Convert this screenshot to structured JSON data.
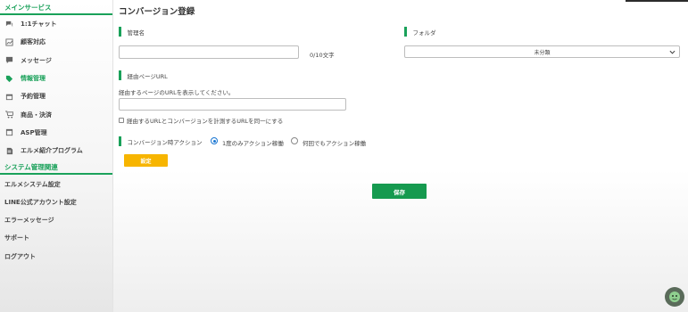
{
  "sidebar": {
    "section_main": "メインサービス",
    "items_main": [
      {
        "label": "1:1チャット",
        "icon": "chat-icon"
      },
      {
        "label": "顧客対応",
        "icon": "chart-icon"
      },
      {
        "label": "メッセージ",
        "icon": "message-icon"
      },
      {
        "label": "情報管理",
        "icon": "tag-icon"
      },
      {
        "label": "予約管理",
        "icon": "calendar-icon"
      },
      {
        "label": "商品・決済",
        "icon": "cart-icon"
      },
      {
        "label": "ASP管理",
        "icon": "window-icon"
      },
      {
        "label": "エルメ紹介プログラム",
        "icon": "document-icon"
      }
    ],
    "section_system": "システム管理関連",
    "items_system": [
      {
        "label": "エルメシステム設定"
      },
      {
        "label": "LINE公式アカウント設定"
      },
      {
        "label": "エラーメッセージ"
      },
      {
        "label": "サポート"
      },
      {
        "label": "ログアウト"
      }
    ]
  },
  "main": {
    "page_title": "コンバージョン登録",
    "name_label": "管理名",
    "name_value": "",
    "name_counter": "0/10文字",
    "folder_label": "フォルダ",
    "folder_value": "未分類",
    "url_label": "経由ページURL",
    "url_hint": "経由するページのURLを表示してください。",
    "url_value": "",
    "same_url_label": "経由するURLとコンバージョンを計測するURLを同一にする",
    "action_label": "コンバージョン時アクション",
    "radio_once": "1度のみアクション稼働",
    "radio_always": "何回でもアクション稼働",
    "setting_button": "設定",
    "save_button": "保存"
  },
  "colors": {
    "accent": "#1aa15a",
    "setting_button": "#f7b500",
    "save_button": "#159a4f"
  }
}
